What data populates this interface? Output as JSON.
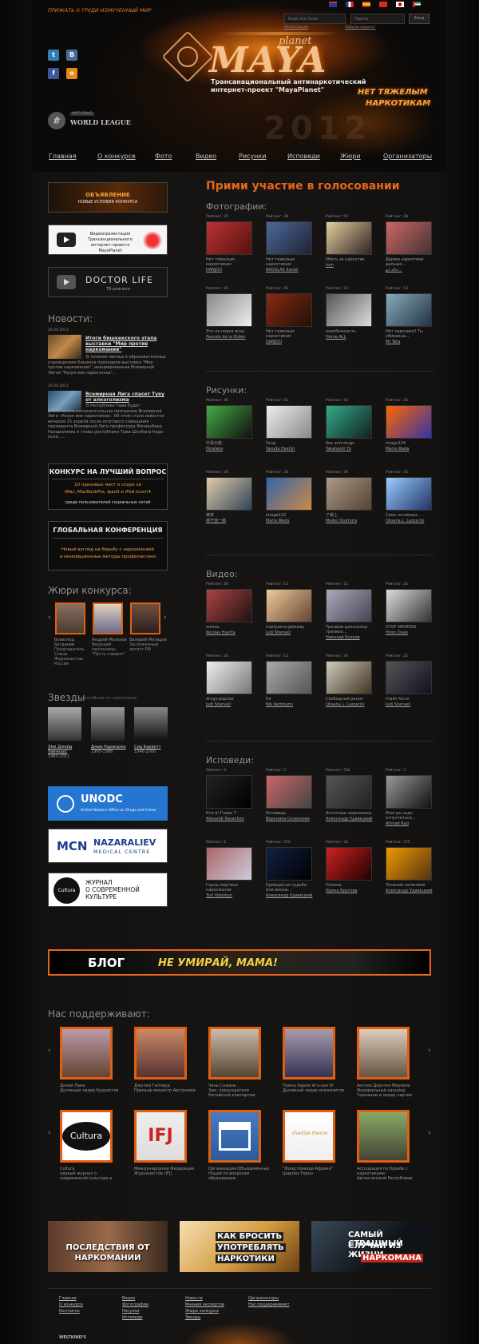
{
  "header": {
    "tagline": "ПРИЖАТЬ К ГРУДИ ИЗМУЧЕННЫЙ МИР",
    "login": {
      "email_placeholder": "Email или Логин",
      "password_placeholder": "Пароль",
      "enter_label": "Вход",
      "register_label": "Регистрация",
      "forgot_label": "Забыли пароль?"
    },
    "logo": {
      "top": "planet",
      "main": "MAYA"
    },
    "subtitle_line1": "Трансанациональный антинаркотический",
    "subtitle_line2": "интернет-проект \"MayaPlanet\"",
    "slogan_line1": "НЕТ ТЯЖЕЛЫМ",
    "slogan_line2": "НАРКОТИКАМ",
    "badge_top": "ANTI-DRUG",
    "badge_bottom": "WORLD LEAGUE",
    "year": "2012"
  },
  "nav": [
    "Главная",
    "О конкурсе",
    "Фото",
    "Видео",
    "Рисунки",
    "Исповеди",
    "Жюри",
    "Организаторы"
  ],
  "sidebar": {
    "announce_line1": "ОБЪЯВЛЕНИЕ",
    "announce_line2": "НОВЫЕ УСЛОВИЯ КОНКУРСА",
    "video_line1": "Видеопрезентация",
    "video_line2": "Трансанционального",
    "video_line3": "интернет-проекта MayaPlanet",
    "doctor_title": "DOCTOR LIFE",
    "doctor_sub": "ТВ-реалити",
    "news_heading": "Новости:",
    "news": [
      {
        "date": "26.04.2013",
        "title": "Итоги бишкекского этапа выставки \"Мир против наркомании\"",
        "text": "В течение месяца в образовательных учреждениях Бишкека проходила выставка \"Мир против наркомании\", инициированная Всемирной Лигой \"Разум вне наркотиков\"..."
      },
      {
        "date": "26.04.2013",
        "title": "Всемирная Лига спасет Туву от алкоголизма",
        "text": "В Республике Тыва будет реализована антиалкогольная программа Всемирной Лиги «Разум вне наркотиков». Об этом стало известно вечером 15 апреля после итогового совещания президента Всемирной Лиги профессора Женишбека Назаралиева и главы республики Тыва Шолбана Кара-оола......"
      }
    ],
    "contest_title": "КОНКУРС НА ЛУЧШИЙ ВОПРОС",
    "contest_line1": "10 призовых мест в споре за",
    "contest_line2": "iMac, MacBookPro, Ipad3 и iPod touch4",
    "contest_line3": "среди пользователей социальных сетей",
    "conf_title": "ГЛОБАЛЬНАЯ КОНФЕРЕНЦИЯ",
    "conf_line1": "Новый взгляд на борьбу с наркоманией",
    "conf_line2": "и инновационные методы профилактики",
    "jury_heading": "Жюри конкурса:",
    "jury": [
      {
        "name": "Всеволод Богданов",
        "desc": "Председатель Союза Журналистов России"
      },
      {
        "name": "Андрей Малахов",
        "desc": "Ведущий программы \"Пусть говорят\""
      },
      {
        "name": "Валерий Меладзе",
        "desc": "Заслуженный артист РФ"
      }
    ],
    "stars_heading": "Звезды",
    "stars_sub": "погибшие от наркотиков",
    "stars": [
      {
        "name": "Эми Джейд Уайнхаус",
        "years": "1983-2011"
      },
      {
        "name": "Джиа Каранджи",
        "years": "1960-1986"
      },
      {
        "name": "Сид Барретт",
        "years": "1946-2006"
      }
    ],
    "unodc_title": "UNODC",
    "unodc_sub": "United Nations Office on Drugs and Crime",
    "mcn_title": "NAZARALIEV",
    "mcn_sub": "MEDICAL CENTRE",
    "mcn_logo": "MCN",
    "cultura_logo": "Cultura",
    "cultura_line1": "ЖУРНАЛ",
    "cultura_line2": "О СОВРЕМЕННОЙ",
    "cultura_line3": "КУЛЬТУРЕ"
  },
  "main": {
    "heading": "Прими участие в голосовании",
    "sections": [
      {
        "title": "Фотографии:",
        "items": [
          {
            "rating": "Рейтинг: 25",
            "caption": "Нет тяжелым наркотикам",
            "author": "DANJOU"
          },
          {
            "rating": "Рейтинг: 38",
            "caption": "Нет тяжелым наркотикам",
            "author": "RAOULAS daniel"
          },
          {
            "rating": "Рейтинг: 50",
            "caption": "Убить за наркотик",
            "author": "tom"
          },
          {
            "rating": "Рейтинг: 28",
            "caption": "Держи наркотики дальше...",
            "author": "خالد ابو..."
          },
          {
            "rating": "Рейтинг: 35",
            "caption": "Это не новая игра",
            "author": "Pascale de la Orden"
          },
          {
            "rating": "Рейтинг: 36",
            "caption": "Нет тяжелым наркотикам",
            "author": "DANJOU"
          },
          {
            "rating": "Рейтинг: 33",
            "caption": "неизбежность",
            "author": "Herve ALL"
          },
          {
            "rating": "Рейтинг: 10",
            "caption": "Нет наркоике! Ты убиваешь...",
            "author": "Mr Tata"
          }
        ]
      },
      {
        "title": "Рисунки:",
        "items": [
          {
            "rating": "Рейтинг: 46",
            "caption": "中毒の底",
            "author": "Hirataka"
          },
          {
            "rating": "Рейтинг: 65",
            "caption": "Drug",
            "author": "Yasuda Hashiri"
          },
          {
            "rating": "Рейтинг: 42",
            "caption": "Sex and drugs",
            "author": "Takahashi Yu"
          },
          {
            "rating": "Рейтинг: 20",
            "caption": "image124",
            "author": "Maria Wada"
          },
          {
            "rating": "Рейтинг: 28",
            "caption": "実体",
            "author": "林千佳一郎"
          },
          {
            "rating": "Рейтинг: 28",
            "caption": "image122",
            "author": "Maria Wada"
          },
          {
            "rating": "Рейтинг: 29",
            "caption": "了解上",
            "author": "Meiko Okumura"
          },
          {
            "rating": "Рейтинг: 45",
            "caption": "Семь основных...",
            "author": "Oksana L. Lazzarini"
          }
        ]
      },
      {
        "title": "Видео:",
        "items": [
          {
            "rating": "Рейтинг: 26",
            "caption": "жизнь",
            "author": "Nicolas Huerta"
          },
          {
            "rating": "Рейтинг: 15",
            "caption": "marijuana-gateway",
            "author": "Judi Shervell"
          },
          {
            "rating": "Рейтинг: 21",
            "caption": "Трезвые-дальнозор-трезвых...",
            "author": "Николай Кузнов"
          },
          {
            "rating": "Рейтинг: 24",
            "caption": "STOP SMOKING",
            "author": "Hiren Dave"
          },
          {
            "rating": "Рейтинг: 20",
            "caption": "drugs-popular",
            "author": "Judi Shervell"
          },
          {
            "rating": "Рейтинг: 13",
            "caption": "fnr",
            "author": "Nik Kettmann"
          },
          {
            "rating": "Рейтинг: 34",
            "caption": "Свободный разум",
            "author": "Oksana L. Lazzarini"
          },
          {
            "rating": "Рейтинг: 22",
            "caption": "ritalin-focus",
            "author": "Judi Shervell"
          }
        ]
      },
      {
        "title": "Исповеди:",
        "items": [
          {
            "rating": "Рейтинг: 0",
            "caption": "Кто я! Глава 7",
            "author": "Alexandr Kasachev"
          },
          {
            "rating": "Рейтинг: 5",
            "caption": "Исповедь",
            "author": "Вероника Селезнева"
          },
          {
            "rating": "Рейтинг: 584",
            "caption": "Аптечные наркоманы",
            "author": "Александр Удавецкий"
          },
          {
            "rating": "Рейтинг: 2",
            "caption": "Иногда надо отпуститься...",
            "author": "Ahmad Rad"
          },
          {
            "rating": "Рейтинг: 2",
            "caption": "Город мертвых наркоманов",
            "author": "Yuri Voloshyn"
          },
          {
            "rating": "Рейтинг: 570",
            "caption": "Криворогая судьба или жизнь...",
            "author": "Александр Удавецкий"
          },
          {
            "rating": "Рейтинг: 32",
            "caption": "Пленка",
            "author": "Ирина Кругова"
          },
          {
            "rating": "Рейтинг: 575",
            "caption": "Лечение молитвой",
            "author": "Александр Удавецкий"
          }
        ]
      }
    ]
  },
  "blog": {
    "label": "БЛОГ",
    "slogan": "НЕ УМИРАЙ, МАМА!"
  },
  "supporters": {
    "heading": "Нас поддерживают:",
    "people": [
      {
        "name": "Далай Лама",
        "desc": "Духовный лидер буддистов"
      },
      {
        "name": "Джулия Гиллард",
        "desc": "Премьер-министр Австралии"
      },
      {
        "name": "Чень Съюань",
        "desc": "Зам. председателя Китайской компартии"
      },
      {
        "name": "Принц Карим Ага-хан IV",
        "desc": "Духовный лидер исмаилитов"
      },
      {
        "name": "Ангела Доротея Меркель",
        "desc": "Федеральный канцлер Германии и лидер партии"
      }
    ],
    "orgs": [
      {
        "name": "Cultura",
        "desc": "первый журнал о современной культуре в"
      },
      {
        "name": "Международная Федерация Журналистов (IFJ)",
        "desc": ""
      },
      {
        "name": "Организация Объединённых Наций по вопросам образования,",
        "desc": ""
      },
      {
        "name": "\"Фонд помощи Африке\" Шарлиз Терон",
        "desc": ""
      },
      {
        "name": "Ассоциация по борьбе с наркотиками",
        "desc": "Аргентинской Республики"
      }
    ],
    "org_logos": {
      "cultura": "Cultura",
      "ifj": "IFJ",
      "theron": "charlize theron"
    }
  },
  "bottom_banners": [
    {
      "line1": "ПОСЛЕДСТВИЯ ОТ",
      "line2": "НАРКОМАНИИ"
    },
    {
      "line1": "КАК БРОСИТЬ",
      "line2": "УПОТРЕБЛЯТЬ",
      "line3": "НАРКОТИКИ"
    },
    {
      "line1": "САМЫЙ СТРАШНЫЙ",
      "line2": "СЛУЧАЙ ИЗ ЖИЗНИ",
      "line3": "НАРКОМАНА"
    }
  ],
  "footer": {
    "col1": [
      "Главная",
      "О конкурсе",
      "Контакты"
    ],
    "col2": [
      "Видео",
      "Фотографии",
      "Рисунки",
      "Исповеди"
    ],
    "col3": [
      "Новости",
      "Мнения экспертов",
      "Жюри конкурса",
      "Звезды"
    ],
    "col4": [
      "Организаторы",
      "Нас поддерживают"
    ],
    "credit": "WELTKIND'S"
  },
  "colors": {
    "accent": "#e8651a",
    "bg": "#141210"
  }
}
